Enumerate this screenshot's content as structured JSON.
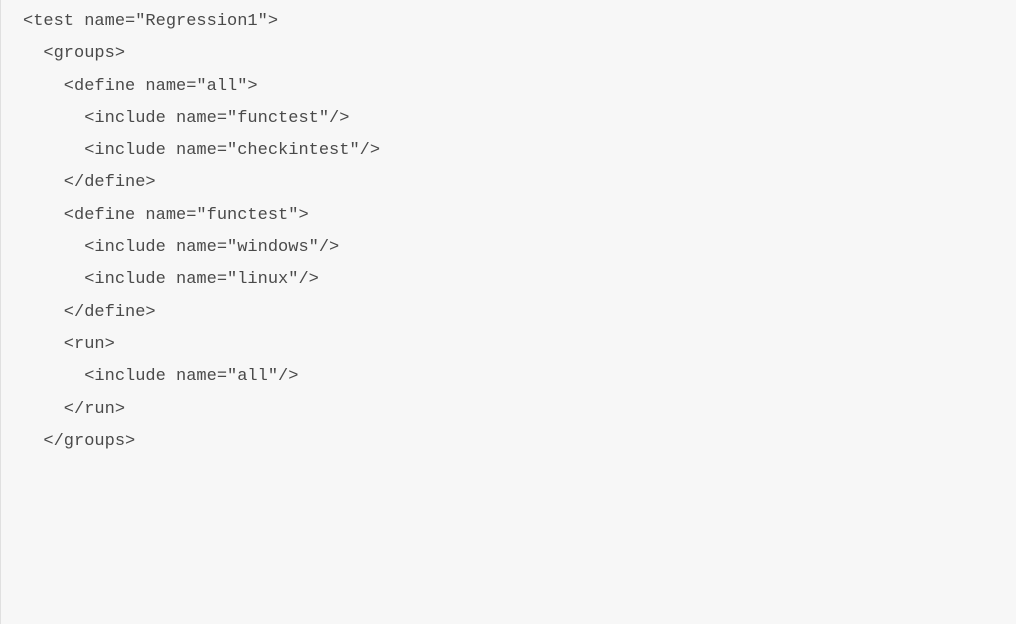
{
  "code": {
    "lines": [
      "<test name=\"Regression1\">",
      "  <groups>",
      "",
      "    <define name=\"all\">",
      "      <include name=\"functest\"/>",
      "      <include name=\"checkintest\"/>",
      "    </define>",
      "",
      "    <define name=\"functest\">",
      "      <include name=\"windows\"/>",
      "      <include name=\"linux\"/>",
      "    </define>",
      "",
      "    <run>",
      "      <include name=\"all\"/>",
      "    </run>",
      "  </groups>"
    ]
  }
}
